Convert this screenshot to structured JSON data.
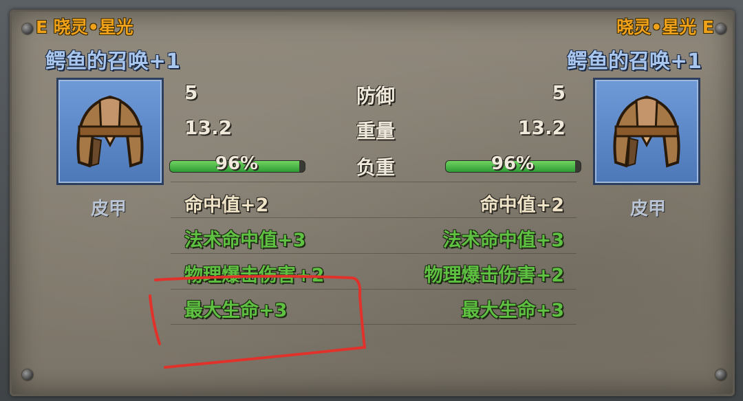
{
  "left": {
    "grade_title": "E 晓灵•星光",
    "item_name": "鳄鱼的召唤+1",
    "type_label": "皮甲",
    "defense": "5",
    "weight": "13.2",
    "load_text": "96%",
    "load_value": 0.96,
    "stats": [
      {
        "text": "命中值+2",
        "color": "cream"
      },
      {
        "text": "法术命中值+3",
        "color": "green"
      },
      {
        "text": "物理爆击伤害+2",
        "color": "green"
      },
      {
        "text": "最大生命+3",
        "color": "green"
      }
    ]
  },
  "right": {
    "grade_title": "晓灵•星光 E",
    "item_name": "鳄鱼的召唤+1",
    "type_label": "皮甲",
    "defense": "5",
    "weight": "13.2",
    "load_text": "96%",
    "load_value": 0.96,
    "stats": [
      {
        "text": "命中值+2",
        "color": "cream"
      },
      {
        "text": "法术命中值+3",
        "color": "green"
      },
      {
        "text": "物理爆击伤害+2",
        "color": "green"
      },
      {
        "text": "最大生命+3",
        "color": "green"
      }
    ]
  },
  "labels": {
    "defense": "防御",
    "weight": "重量",
    "load": "负重"
  },
  "icons": {
    "left_item": "leather-helmet-icon",
    "right_item": "leather-helmet-icon"
  },
  "colors": {
    "grade": "#f0a21a",
    "name": "#a9c6ee",
    "green_stat": "#5ec142",
    "red_annotation": "#e0322b"
  }
}
